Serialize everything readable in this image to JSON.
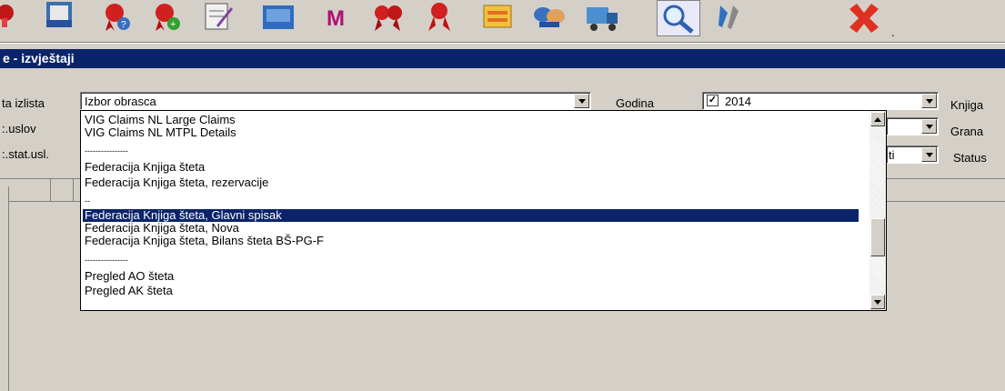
{
  "toolbar": {
    "icons": [
      "award-icon",
      "document-icon",
      "ribbon-question-icon",
      "ribbon-plus-icon",
      "edit-icon",
      "folder-icon",
      "chart-icon",
      "ribbon-cluster-icon",
      "ribbon-icon",
      "card-icon",
      "handshake-icon",
      "truck-icon",
      "search-icon",
      "tools-icon",
      "close-icon"
    ],
    "more": "."
  },
  "window": {
    "title": "e - izvještaji"
  },
  "form": {
    "labels": {
      "row1": "ta izlista",
      "row2": ":.uslov",
      "row3": ":.stat.usl."
    },
    "obrazac": {
      "value": "Izbor obrasca"
    },
    "godina": {
      "label": "Godina",
      "checkbox": "✓",
      "value": "2014"
    },
    "knjiga": {
      "label": "Knjiga"
    },
    "grana": {
      "label": "Grana"
    },
    "status": {
      "label": "Status",
      "partial_value": "ti"
    }
  },
  "dropdown": {
    "items": [
      "VIG Claims NL Large Claims",
      "VIG Claims NL MTPL Details",
      "----------------",
      "Federacija Knjiga šteta",
      "Federacija Knjiga šteta, rezervacije",
      "--",
      "Federacija Knjiga šteta, Glavni spisak",
      "Federacija Knjiga šteta, Nova",
      "Federacija Knjiga šteta, Bilans šteta BŠ-PG-F",
      "----------------",
      "Pregled AO šteta",
      "Pregled AK šteta"
    ],
    "selected_index": 6
  },
  "colors": {
    "selection": "#0a246a",
    "face": "#d4d0c8"
  }
}
